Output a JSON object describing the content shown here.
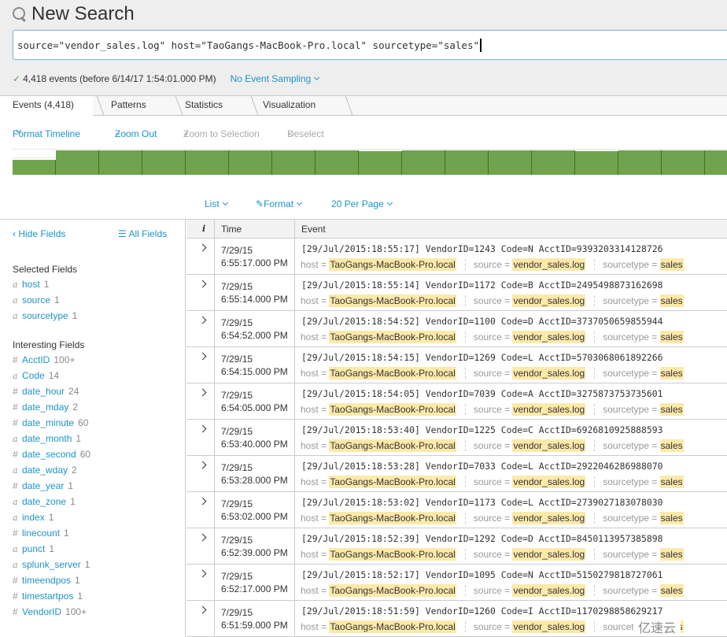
{
  "header": {
    "title": "New Search",
    "search_query": "source=\"vendor_sales.log\" host=\"TaoGangs-MacBook-Pro.local\" sourcetype=\"sales\""
  },
  "status": {
    "events_text": "4,418 events (before 6/14/17 1:54:01.000 PM)",
    "sampling_label": "No Event Sampling"
  },
  "tabs": [
    {
      "label": "Events (4,418)",
      "active": true
    },
    {
      "label": "Patterns",
      "active": false
    },
    {
      "label": "Statistics",
      "active": false
    },
    {
      "label": "Visualization",
      "active": false
    }
  ],
  "timeline_actions": {
    "format_timeline": "Format Timeline",
    "zoom_out": "Zoom Out",
    "zoom_to_selection": "Zoom to Selection",
    "deselect": "Deselect"
  },
  "timeline": {
    "relative_heights": [
      0.6,
      1,
      1,
      1,
      1,
      1,
      1,
      1,
      0.97,
      1,
      1,
      1,
      1,
      0.97,
      1,
      1,
      1
    ]
  },
  "list_controls": {
    "list": "List",
    "format": "Format",
    "per_page": "20 Per Page"
  },
  "sidebar": {
    "hide_fields": "Hide Fields",
    "all_fields": "All Fields",
    "selected_heading": "Selected Fields",
    "selected": [
      {
        "type": "a",
        "name": "host",
        "count": "1"
      },
      {
        "type": "a",
        "name": "source",
        "count": "1"
      },
      {
        "type": "a",
        "name": "sourcetype",
        "count": "1"
      }
    ],
    "interesting_heading": "Interesting Fields",
    "interesting": [
      {
        "type": "#",
        "name": "AcctID",
        "count": "100+"
      },
      {
        "type": "a",
        "name": "Code",
        "count": "14"
      },
      {
        "type": "#",
        "name": "date_hour",
        "count": "24"
      },
      {
        "type": "#",
        "name": "date_mday",
        "count": "2"
      },
      {
        "type": "#",
        "name": "date_minute",
        "count": "60"
      },
      {
        "type": "a",
        "name": "date_month",
        "count": "1"
      },
      {
        "type": "#",
        "name": "date_second",
        "count": "60"
      },
      {
        "type": "a",
        "name": "date_wday",
        "count": "2"
      },
      {
        "type": "#",
        "name": "date_year",
        "count": "1"
      },
      {
        "type": "a",
        "name": "date_zone",
        "count": "1"
      },
      {
        "type": "a",
        "name": "index",
        "count": "1"
      },
      {
        "type": "#",
        "name": "linecount",
        "count": "1"
      },
      {
        "type": "a",
        "name": "punct",
        "count": "1"
      },
      {
        "type": "a",
        "name": "splunk_server",
        "count": "1"
      },
      {
        "type": "#",
        "name": "timeendpos",
        "count": "1"
      },
      {
        "type": "#",
        "name": "timestartpos",
        "count": "1"
      },
      {
        "type": "#",
        "name": "VendorID",
        "count": "100+"
      }
    ]
  },
  "table": {
    "col_info": "i",
    "col_time": "Time",
    "col_event": "Event",
    "meta_labels": {
      "host": "host =",
      "source": "source =",
      "sourcetype": "sourcetype ="
    },
    "rows": [
      {
        "date": "7/29/15",
        "time": "6:55:17.000 PM",
        "raw": "[29/Jul/2015:18:55:17] VendorID=1243 Code=N AcctID=9393203314128726",
        "host": "TaoGangs-MacBook-Pro.local",
        "source": "vendor_sales.log",
        "sourcetype": "sales"
      },
      {
        "date": "7/29/15",
        "time": "6:55:14.000 PM",
        "raw": "[29/Jul/2015:18:55:14] VendorID=1172 Code=B AcctID=2495498873162698",
        "host": "TaoGangs-MacBook-Pro.local",
        "source": "vendor_sales.log",
        "sourcetype": "sales"
      },
      {
        "date": "7/29/15",
        "time": "6:54:52.000 PM",
        "raw": "[29/Jul/2015:18:54:52] VendorID=1100 Code=D AcctID=3737050659855944",
        "host": "TaoGangs-MacBook-Pro.local",
        "source": "vendor_sales.log",
        "sourcetype": "sales"
      },
      {
        "date": "7/29/15",
        "time": "6:54:15.000 PM",
        "raw": "[29/Jul/2015:18:54:15] VendorID=1269 Code=L AcctID=5703068061892266",
        "host": "TaoGangs-MacBook-Pro.local",
        "source": "vendor_sales.log",
        "sourcetype": "sales"
      },
      {
        "date": "7/29/15",
        "time": "6:54:05.000 PM",
        "raw": "[29/Jul/2015:18:54:05] VendorID=7039 Code=A AcctID=3275873753735601",
        "host": "TaoGangs-MacBook-Pro.local",
        "source": "vendor_sales.log",
        "sourcetype": "sales"
      },
      {
        "date": "7/29/15",
        "time": "6:53:40.000 PM",
        "raw": "[29/Jul/2015:18:53:40] VendorID=1225 Code=C AcctID=6926810925888593",
        "host": "TaoGangs-MacBook-Pro.local",
        "source": "vendor_sales.log",
        "sourcetype": "sales"
      },
      {
        "date": "7/29/15",
        "time": "6:53:28.000 PM",
        "raw": "[29/Jul/2015:18:53:28] VendorID=7033 Code=L AcctID=2922046286988070",
        "host": "TaoGangs-MacBook-Pro.local",
        "source": "vendor_sales.log",
        "sourcetype": "sales"
      },
      {
        "date": "7/29/15",
        "time": "6:53:02.000 PM",
        "raw": "[29/Jul/2015:18:53:02] VendorID=1173 Code=L AcctID=2739027183078030",
        "host": "TaoGangs-MacBook-Pro.local",
        "source": "vendor_sales.log",
        "sourcetype": "sales"
      },
      {
        "date": "7/29/15",
        "time": "6:52:39.000 PM",
        "raw": "[29/Jul/2015:18:52:39] VendorID=1292 Code=D AcctID=8450113957385898",
        "host": "TaoGangs-MacBook-Pro.local",
        "source": "vendor_sales.log",
        "sourcetype": "sales"
      },
      {
        "date": "7/29/15",
        "time": "6:52:17.000 PM",
        "raw": "[29/Jul/2015:18:52:17] VendorID=1095 Code=N AcctID=5150279818727061",
        "host": "TaoGangs-MacBook-Pro.local",
        "source": "vendor_sales.log",
        "sourcetype": "sales"
      },
      {
        "date": "7/29/15",
        "time": "6:51:59.000 PM",
        "raw": "[29/Jul/2015:18:51:59] VendorID=1260 Code=I AcctID=1170298858629217",
        "host": "TaoGangs-MacBook-Pro.local",
        "source": "vendor_sales.log",
        "sourcetype": "sales"
      }
    ]
  },
  "watermark": "亿速云"
}
